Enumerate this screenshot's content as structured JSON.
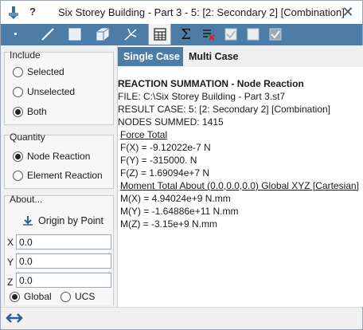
{
  "window": {
    "title": "Six Storey Building - Part 3 - 5: [2: Secondary 2] [Combination]",
    "help_label": "?",
    "close_label": "✕"
  },
  "toolbar": {
    "buttons": [
      {
        "name": "node-icon"
      },
      {
        "name": "beam-icon"
      },
      {
        "name": "plate-icon"
      },
      {
        "name": "solid-icon"
      },
      {
        "name": "support-icon"
      },
      {
        "name": "table-icon"
      },
      {
        "name": "sum-icon"
      },
      {
        "name": "delete-icon"
      },
      {
        "name": "checkbox-checked-icon"
      },
      {
        "name": "checkbox-empty-icon"
      },
      {
        "name": "checkbox-filled-icon"
      }
    ],
    "sum_glyph": "Σ",
    "accent_color": "#4d7ca6"
  },
  "include": {
    "title": "Include",
    "options": [
      {
        "label": "Selected",
        "checked": false
      },
      {
        "label": "Unselected",
        "checked": false
      },
      {
        "label": "Both",
        "checked": true
      }
    ]
  },
  "quantity": {
    "title": "Quantity",
    "options": [
      {
        "label": "Node Reaction",
        "checked": true
      },
      {
        "label": "Element Reaction",
        "checked": false
      }
    ]
  },
  "about": {
    "title": "About...",
    "origin_button": "Origin by Point",
    "x_label": "X",
    "y_label": "Y",
    "z_label": "Z",
    "x_value": "0.0",
    "y_value": "0.0",
    "z_value": "0.0",
    "global_label": "Global",
    "ucs_label": "UCS",
    "global_checked": true
  },
  "tabs": {
    "single": "Single Case",
    "multi": "Multi Case"
  },
  "report": {
    "heading": "REACTION SUMMATION - Node Reaction",
    "file": "FILE: C:\\Six Storey Building - Part 3.st7",
    "result_case": "RESULT CASE: 5: [2: Secondary 2] [Combination]",
    "nodes": "NODES SUMMED: 1415",
    "force_title": "Force Total",
    "fx": "F(X)  = -9.12022e-7 N",
    "fy": "F(Y)  = -315000. N",
    "fz": "F(Z)  = 1.69094e+7 N",
    "moment_title": "Moment Total About (0.0,0.0,0.0) Global XYZ [Cartesian]",
    "mx": "M(X)  = 4.94024e+9 N.mm",
    "my": "M(Y)  = -1.64886e+11 N.mm",
    "mz": "M(Z)  = -3.15e+9 N.mm"
  }
}
